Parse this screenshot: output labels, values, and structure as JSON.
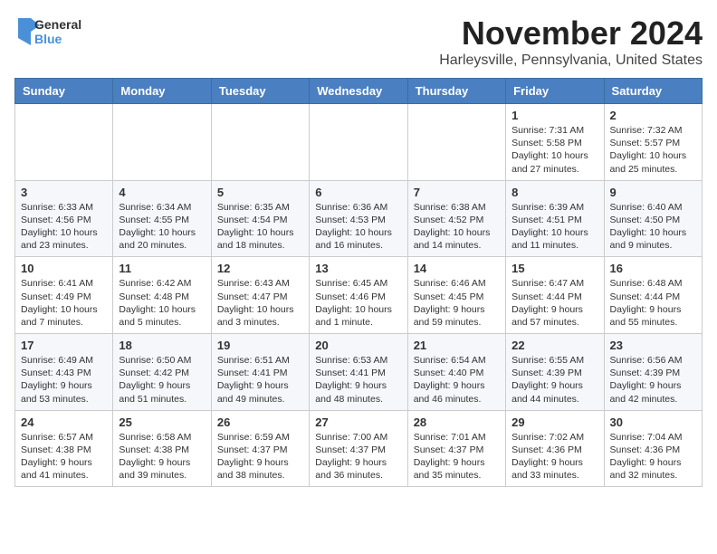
{
  "logo": {
    "line1": "General",
    "line2": "Blue"
  },
  "title": "November 2024",
  "location": "Harleysville, Pennsylvania, United States",
  "days_of_week": [
    "Sunday",
    "Monday",
    "Tuesday",
    "Wednesday",
    "Thursday",
    "Friday",
    "Saturday"
  ],
  "weeks": [
    [
      {
        "day": "",
        "info": ""
      },
      {
        "day": "",
        "info": ""
      },
      {
        "day": "",
        "info": ""
      },
      {
        "day": "",
        "info": ""
      },
      {
        "day": "",
        "info": ""
      },
      {
        "day": "1",
        "info": "Sunrise: 7:31 AM\nSunset: 5:58 PM\nDaylight: 10 hours and 27 minutes."
      },
      {
        "day": "2",
        "info": "Sunrise: 7:32 AM\nSunset: 5:57 PM\nDaylight: 10 hours and 25 minutes."
      }
    ],
    [
      {
        "day": "3",
        "info": "Sunrise: 6:33 AM\nSunset: 4:56 PM\nDaylight: 10 hours and 23 minutes."
      },
      {
        "day": "4",
        "info": "Sunrise: 6:34 AM\nSunset: 4:55 PM\nDaylight: 10 hours and 20 minutes."
      },
      {
        "day": "5",
        "info": "Sunrise: 6:35 AM\nSunset: 4:54 PM\nDaylight: 10 hours and 18 minutes."
      },
      {
        "day": "6",
        "info": "Sunrise: 6:36 AM\nSunset: 4:53 PM\nDaylight: 10 hours and 16 minutes."
      },
      {
        "day": "7",
        "info": "Sunrise: 6:38 AM\nSunset: 4:52 PM\nDaylight: 10 hours and 14 minutes."
      },
      {
        "day": "8",
        "info": "Sunrise: 6:39 AM\nSunset: 4:51 PM\nDaylight: 10 hours and 11 minutes."
      },
      {
        "day": "9",
        "info": "Sunrise: 6:40 AM\nSunset: 4:50 PM\nDaylight: 10 hours and 9 minutes."
      }
    ],
    [
      {
        "day": "10",
        "info": "Sunrise: 6:41 AM\nSunset: 4:49 PM\nDaylight: 10 hours and 7 minutes."
      },
      {
        "day": "11",
        "info": "Sunrise: 6:42 AM\nSunset: 4:48 PM\nDaylight: 10 hours and 5 minutes."
      },
      {
        "day": "12",
        "info": "Sunrise: 6:43 AM\nSunset: 4:47 PM\nDaylight: 10 hours and 3 minutes."
      },
      {
        "day": "13",
        "info": "Sunrise: 6:45 AM\nSunset: 4:46 PM\nDaylight: 10 hours and 1 minute."
      },
      {
        "day": "14",
        "info": "Sunrise: 6:46 AM\nSunset: 4:45 PM\nDaylight: 9 hours and 59 minutes."
      },
      {
        "day": "15",
        "info": "Sunrise: 6:47 AM\nSunset: 4:44 PM\nDaylight: 9 hours and 57 minutes."
      },
      {
        "day": "16",
        "info": "Sunrise: 6:48 AM\nSunset: 4:44 PM\nDaylight: 9 hours and 55 minutes."
      }
    ],
    [
      {
        "day": "17",
        "info": "Sunrise: 6:49 AM\nSunset: 4:43 PM\nDaylight: 9 hours and 53 minutes."
      },
      {
        "day": "18",
        "info": "Sunrise: 6:50 AM\nSunset: 4:42 PM\nDaylight: 9 hours and 51 minutes."
      },
      {
        "day": "19",
        "info": "Sunrise: 6:51 AM\nSunset: 4:41 PM\nDaylight: 9 hours and 49 minutes."
      },
      {
        "day": "20",
        "info": "Sunrise: 6:53 AM\nSunset: 4:41 PM\nDaylight: 9 hours and 48 minutes."
      },
      {
        "day": "21",
        "info": "Sunrise: 6:54 AM\nSunset: 4:40 PM\nDaylight: 9 hours and 46 minutes."
      },
      {
        "day": "22",
        "info": "Sunrise: 6:55 AM\nSunset: 4:39 PM\nDaylight: 9 hours and 44 minutes."
      },
      {
        "day": "23",
        "info": "Sunrise: 6:56 AM\nSunset: 4:39 PM\nDaylight: 9 hours and 42 minutes."
      }
    ],
    [
      {
        "day": "24",
        "info": "Sunrise: 6:57 AM\nSunset: 4:38 PM\nDaylight: 9 hours and 41 minutes."
      },
      {
        "day": "25",
        "info": "Sunrise: 6:58 AM\nSunset: 4:38 PM\nDaylight: 9 hours and 39 minutes."
      },
      {
        "day": "26",
        "info": "Sunrise: 6:59 AM\nSunset: 4:37 PM\nDaylight: 9 hours and 38 minutes."
      },
      {
        "day": "27",
        "info": "Sunrise: 7:00 AM\nSunset: 4:37 PM\nDaylight: 9 hours and 36 minutes."
      },
      {
        "day": "28",
        "info": "Sunrise: 7:01 AM\nSunset: 4:37 PM\nDaylight: 9 hours and 35 minutes."
      },
      {
        "day": "29",
        "info": "Sunrise: 7:02 AM\nSunset: 4:36 PM\nDaylight: 9 hours and 33 minutes."
      },
      {
        "day": "30",
        "info": "Sunrise: 7:04 AM\nSunset: 4:36 PM\nDaylight: 9 hours and 32 minutes."
      }
    ]
  ]
}
